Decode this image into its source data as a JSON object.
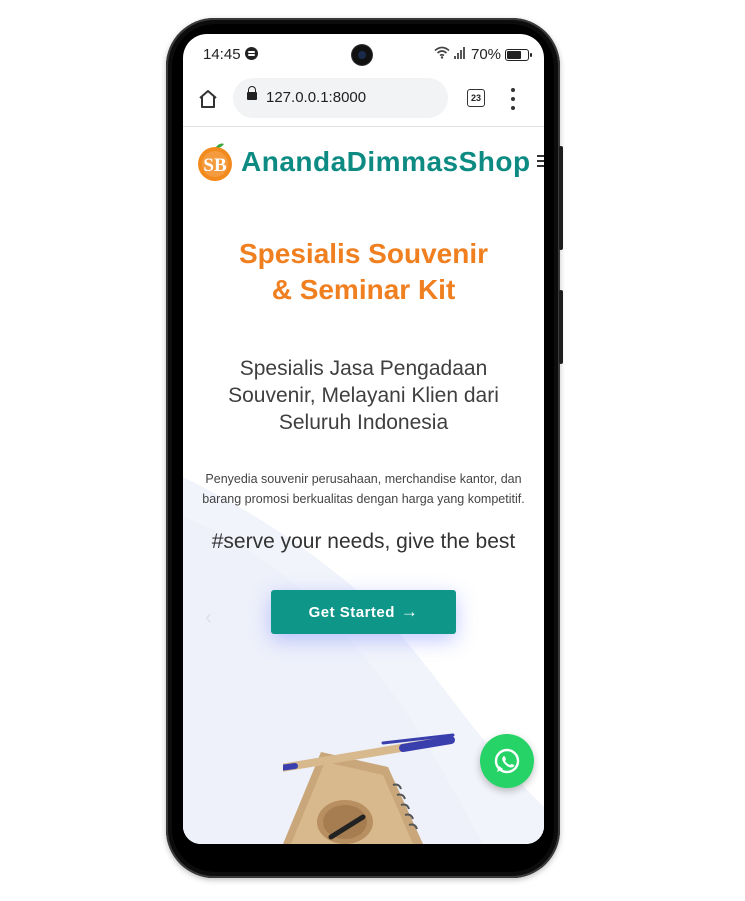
{
  "status_bar": {
    "time": "14:45",
    "battery_percent": "70%",
    "icons": [
      "spotify-icon",
      "wifi-icon",
      "signal-icon",
      "battery-icon"
    ]
  },
  "browser": {
    "url": "127.0.0.1:8000",
    "tab_count": "23",
    "icons": [
      "home-icon",
      "lock-icon",
      "tabs-icon",
      "menu-icon"
    ]
  },
  "site": {
    "logo_text": "SB",
    "brand_name": "AnandaDimmasShop"
  },
  "hero": {
    "title_line1": "Spesialis Souvenir",
    "title_line2": "& Seminar Kit",
    "subtitle_line1": "Spesialis Jasa Pengadaan",
    "subtitle_line2": "Souvenir, Melayani Klien dari",
    "subtitle_line3": "Seluruh Indonesia",
    "description_line1": "Penyedia souvenir perusahaan, merchandise kantor, dan",
    "description_line2": "barang promosi berkualitas dengan harga yang kompetitif.",
    "tagline": "#serve your needs, give the best",
    "cta_label": "Get Started",
    "cta_arrow": "→"
  },
  "colors": {
    "brand_teal": "#0d8b83",
    "accent_orange": "#f07f1f",
    "button_teal": "#0e9688",
    "whatsapp_green": "#25d366"
  }
}
